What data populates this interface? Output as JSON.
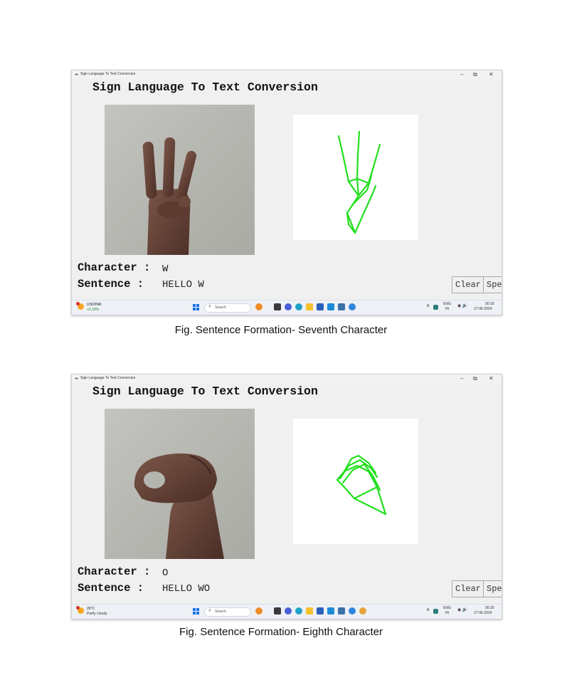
{
  "figures": [
    {
      "window_title": "Sign Language To Text Conversion",
      "heading": "Sign Language To Text Conversion",
      "character_label": "Character :",
      "character_value": "W",
      "sentence_label": "Sentence :",
      "sentence_value": "HELLO W",
      "clear_label": "Clear",
      "speak_label_visible": "Spe",
      "taskbar": {
        "weather_line1": "USD/INR",
        "weather_line2": "+0.18%",
        "search_placeholder": "Search",
        "lang_top": "ENG",
        "lang_bottom": "IN",
        "time": "00:18",
        "date": "27-06-2024"
      },
      "caption": "Fig. Sentence Formation- Seventh Character"
    },
    {
      "window_title": "Sign Language To Text Conversion",
      "heading": "Sign Language To Text Conversion",
      "character_label": "Character :",
      "character_value": "O",
      "sentence_label": "Sentence :",
      "sentence_value": "HELLO WO",
      "clear_label": "Clear",
      "speak_label_visible": "Spe",
      "taskbar": {
        "weather_line1": "26°C",
        "weather_line2": "Partly cloudy",
        "search_placeholder": "Search",
        "lang_top": "ENG",
        "lang_bottom": "IN",
        "time": "00:20",
        "date": "27-06-2024"
      },
      "caption": "Fig. Sentence Formation- Eighth Character"
    }
  ],
  "colors": {
    "skeleton_line": "#22e01e",
    "window_bg": "#f0f0f0",
    "taskbar_bg": "#eef1f6",
    "start_blue": "#1a73e8"
  }
}
